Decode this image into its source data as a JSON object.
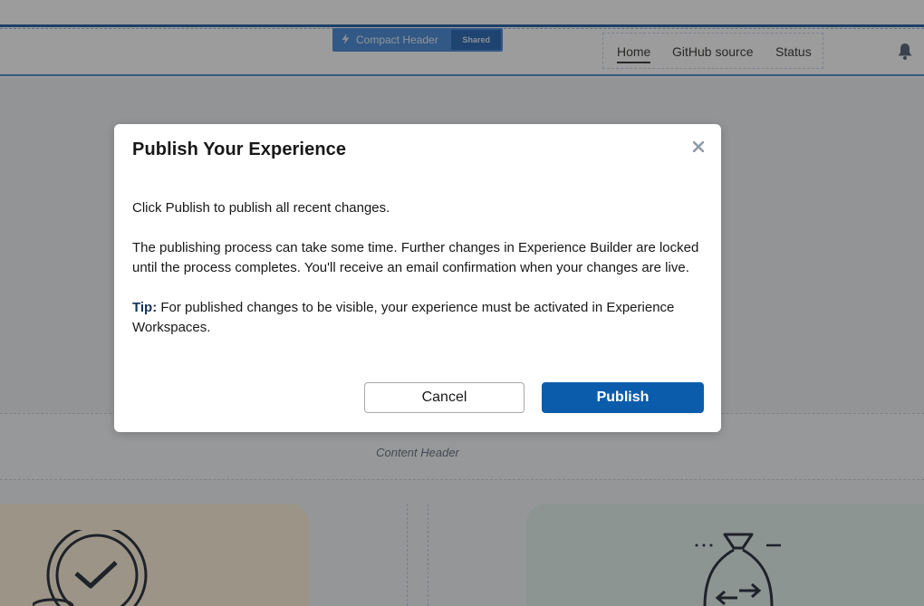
{
  "header": {
    "compact_tag": {
      "icon": "lightning-bolt-icon",
      "label": "Compact Header",
      "badge": "Shared"
    },
    "nav": {
      "items": [
        {
          "label": "Home",
          "active": true
        },
        {
          "label": "GitHub source",
          "active": false
        },
        {
          "label": "Status",
          "active": false
        }
      ]
    },
    "notifications_icon": "bell-icon"
  },
  "content_header": {
    "label": "Content Header"
  },
  "modal": {
    "title": "Publish Your Experience",
    "close_icon": "close-icon",
    "body": {
      "paragraph_1": "Click Publish to publish all recent changes.",
      "paragraph_2": "The publishing process can take some time. Further changes in Experience Builder are locked until the process completes. You'll receive an email confirmation when your changes are live.",
      "tip_label": "Tip:",
      "tip_text": " For published changes to be visible, your experience must be activated in Experience Workspaces."
    },
    "buttons": {
      "cancel_label": "Cancel",
      "publish_label": "Publish"
    }
  },
  "colors": {
    "primary_button": "#0b5cab",
    "tip_label": "#16325c",
    "header_accent": "#2a65a8",
    "compact_tag": "#4f8edb"
  }
}
